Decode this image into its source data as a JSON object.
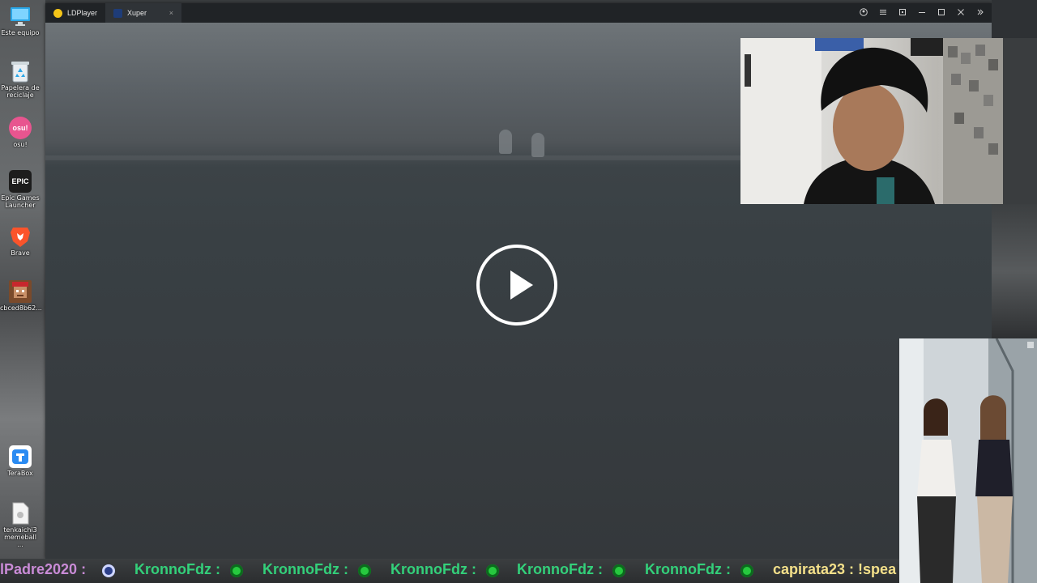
{
  "desktop": {
    "icons": [
      {
        "label": "Este equipo",
        "icon": "monitor-icon"
      },
      {
        "label": "Papelera de reciclaje",
        "icon": "recycle-bin-icon"
      },
      {
        "label": "osu!",
        "icon": "osu-icon"
      },
      {
        "label": "Epic Games Launcher",
        "icon": "epic-games-icon"
      },
      {
        "label": "Brave",
        "icon": "brave-lion-icon"
      },
      {
        "label": "cbced8b62...",
        "icon": "minecraft-skin-icon"
      },
      {
        "label": "TeraBox",
        "icon": "terabox-icon"
      },
      {
        "label": "tenkaichi3 memeball ...",
        "icon": "file-icon"
      }
    ]
  },
  "window": {
    "tabs": [
      {
        "label": "LDPlayer",
        "icon": "ldplayer-icon",
        "active": false
      },
      {
        "label": "Xuper",
        "icon": "xuper-icon",
        "active": true,
        "close": "×"
      }
    ],
    "controls": [
      "account-icon",
      "menu-icon",
      "sync-icon",
      "minimize-icon",
      "maximize-icon",
      "close-icon",
      "expand-icon"
    ]
  },
  "player": {
    "state": "paused",
    "icon": "play-icon"
  },
  "chat_ticker": [
    {
      "text": "lPadre2020 :",
      "color": "#c98bd6"
    },
    {
      "text": "KronnoFdz :",
      "color": "#33d07a"
    },
    {
      "text": "KronnoFdz :",
      "color": "#33d07a"
    },
    {
      "text": "KronnoFdz :",
      "color": "#33d07a"
    },
    {
      "text": "KronnoFdz :",
      "color": "#33d07a"
    },
    {
      "text": "KronnoFdz :",
      "color": "#33d07a"
    },
    {
      "text": "capirata23 : !spea",
      "color": "#f4e08a"
    }
  ]
}
